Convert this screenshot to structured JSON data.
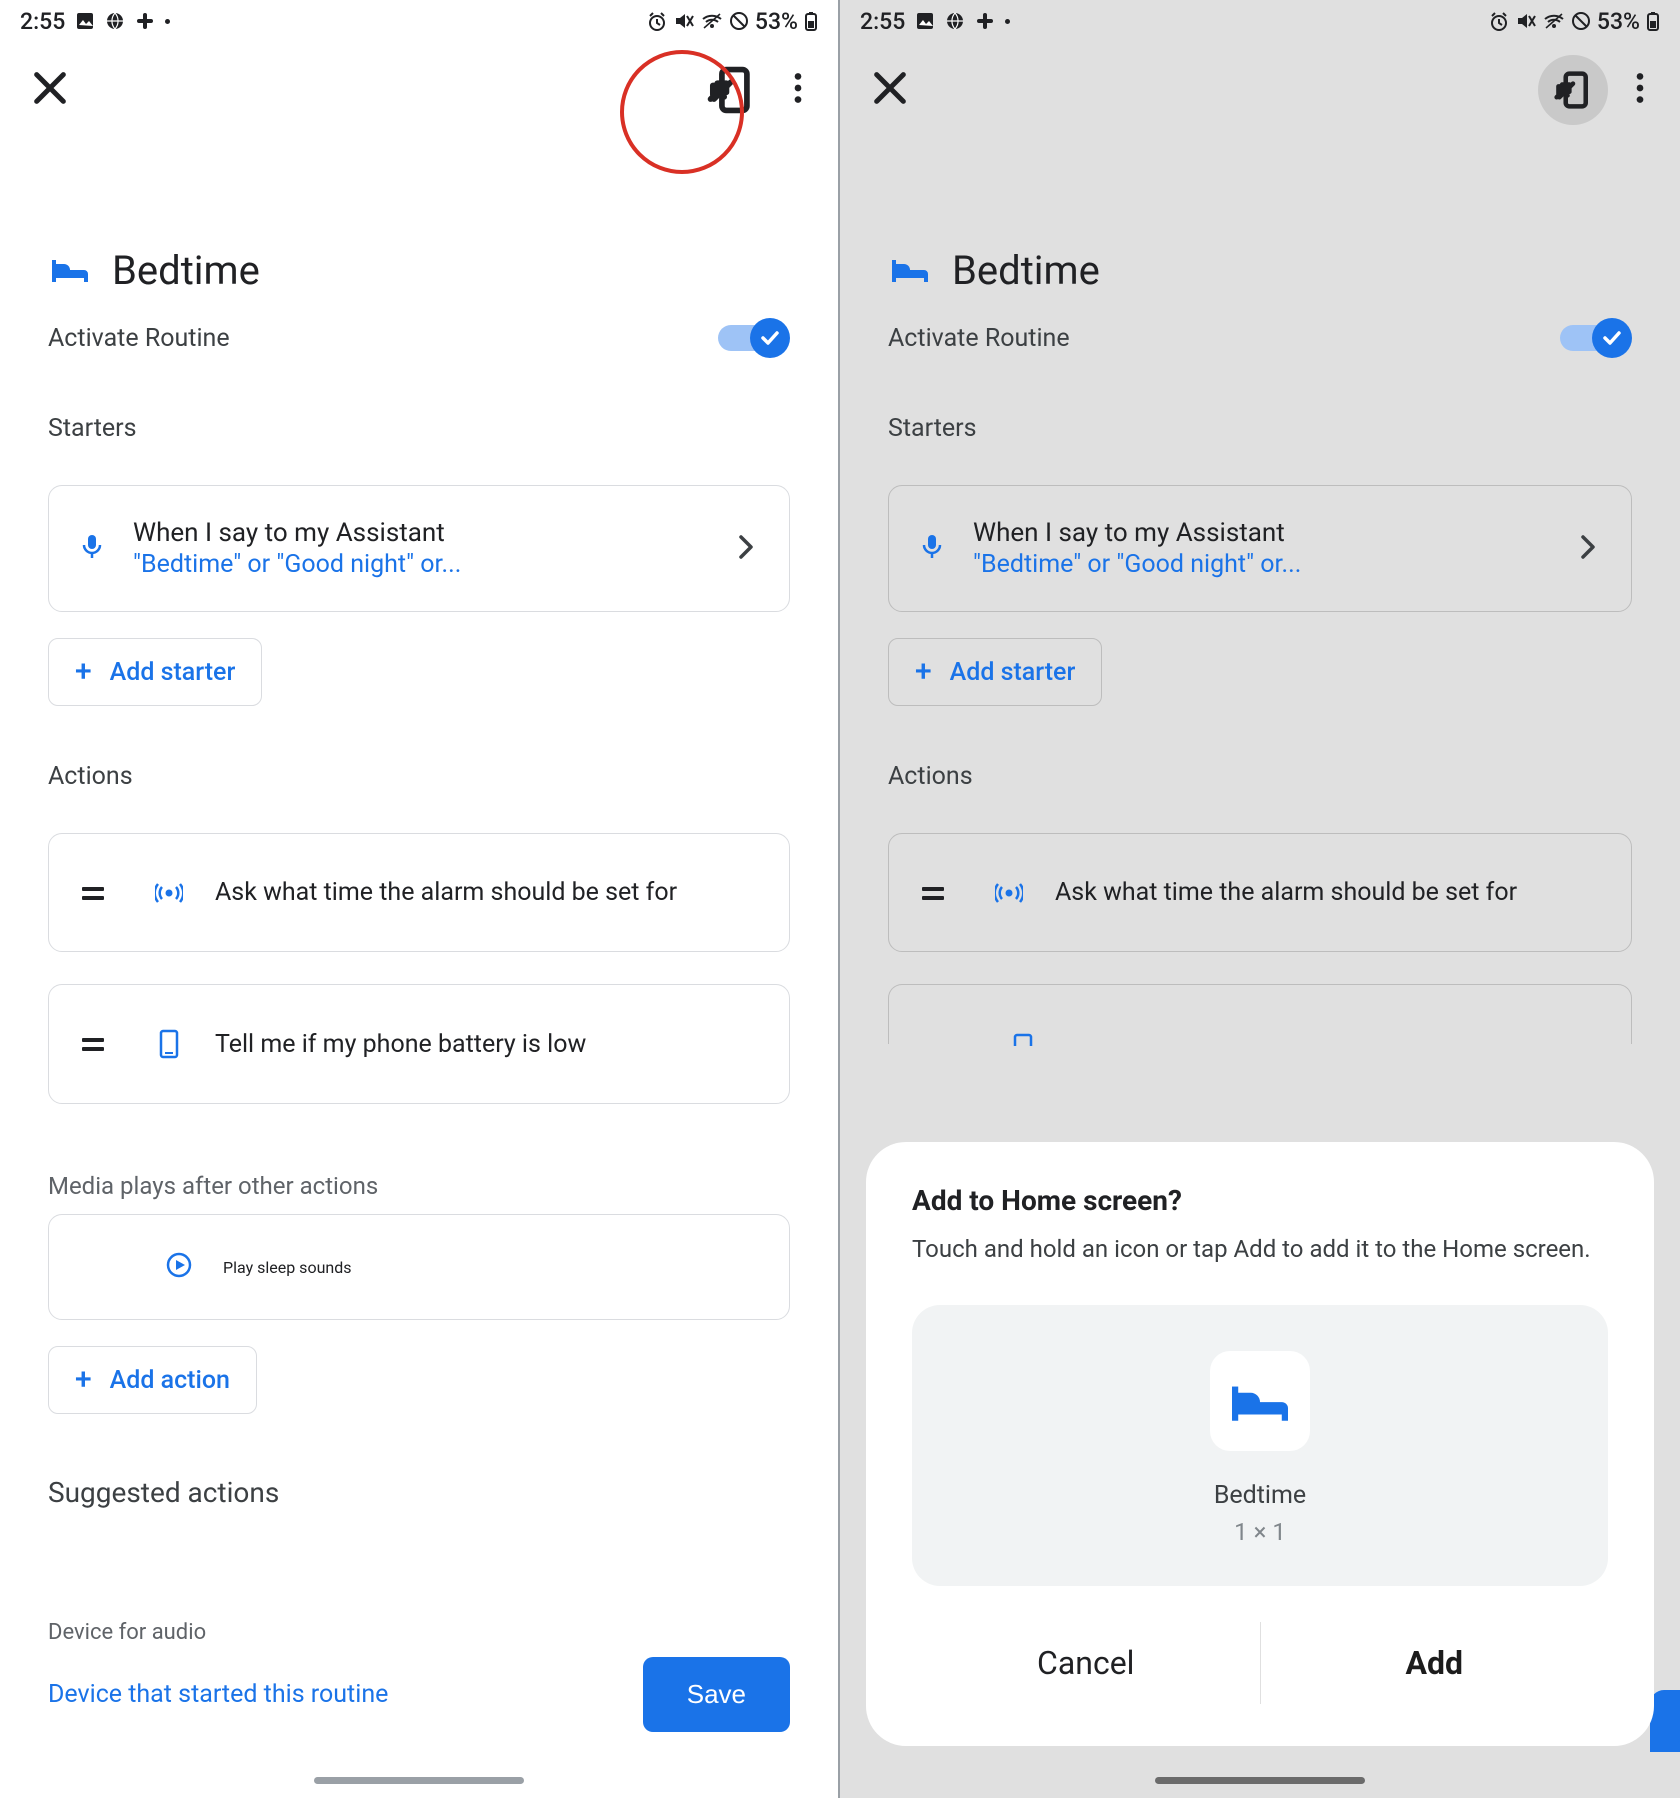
{
  "status": {
    "time": "2:55",
    "battery_text": "53%"
  },
  "routine": {
    "title": "Bedtime",
    "activate_label": "Activate Routine",
    "starters_label": "Starters",
    "starter": {
      "line1": "When I say to my Assistant",
      "line2": "\"Bedtime\" or \"Good night\" or..."
    },
    "add_starter_label": "Add starter",
    "actions_label": "Actions",
    "action_alarm": "Ask what time the alarm should be set for",
    "action_battery": "Tell me if my phone battery is low",
    "media_label": "Media plays after other actions",
    "media_action": "Play sleep sounds",
    "add_action_label": "Add action",
    "suggested_label": "Suggested actions"
  },
  "footer": {
    "device_for_audio": "Device for audio",
    "device_link": "Device that started this routine",
    "save_label": "Save"
  },
  "dialog": {
    "title": "Add to Home screen?",
    "body": "Touch and hold an icon or tap Add to add it to the Home screen.",
    "preview_name": "Bedtime",
    "preview_size": "1 × 1",
    "cancel": "Cancel",
    "add": "Add"
  }
}
